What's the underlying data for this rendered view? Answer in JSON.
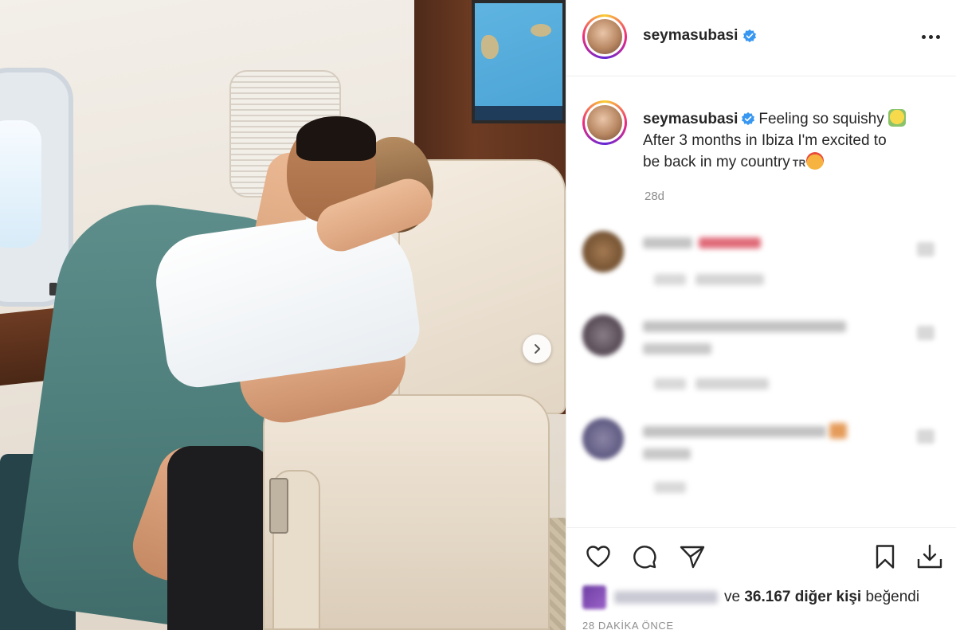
{
  "post": {
    "username": "seymasubasi",
    "verified": true,
    "caption": {
      "username": "seymasubasi",
      "line1": "Feeling so squishy",
      "line2": "After 3 months in Ibiza I'm excited to",
      "line3_prefix": "be back in my country",
      "flag_text": "TR",
      "relative_time": "28d"
    },
    "likes": {
      "prefix": "ve",
      "count": "36.167",
      "suffix_bold": "diğer kişi",
      "suffix": "beğendi"
    },
    "posted_ago": "28 DAKİKA ÖNCE"
  },
  "icons": {
    "verified": "verified-badge-icon",
    "more": "more-options-icon",
    "next": "chevron-right-icon",
    "like": "heart-icon",
    "comment": "comment-bubble-icon",
    "share": "paper-plane-icon",
    "save": "bookmark-icon",
    "download": "download-icon"
  },
  "colors": {
    "verified_blue": "#3897f0",
    "text": "#262626",
    "muted": "#8e8e8e",
    "divider": "#efefef"
  }
}
